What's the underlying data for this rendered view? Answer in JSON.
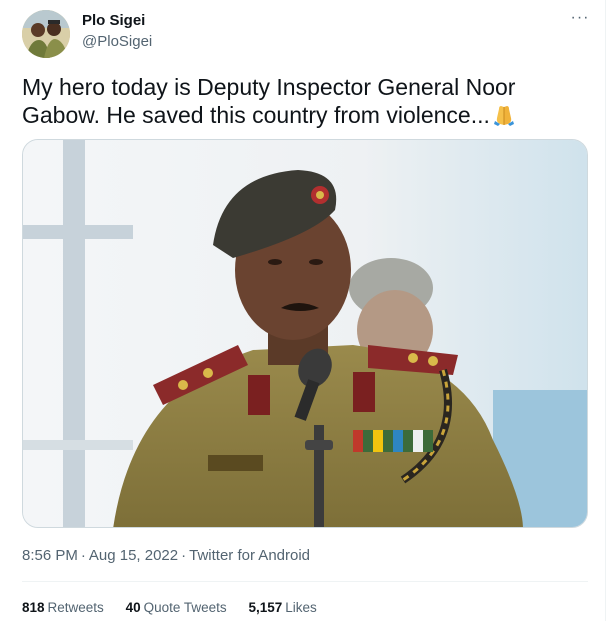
{
  "tweet": {
    "author": {
      "name": "Plo Sigei",
      "handle": "@PloSigei"
    },
    "more_icon": "more-horizontal-icon",
    "text": "My hero today is Deputy Inspector General Noor Gabow. He saved this country from violence...",
    "emoji": "folded-hands-emoji",
    "media": {
      "subject": "photo-man-in-military-uniform-speaking-at-microphone"
    },
    "meta": {
      "time": "8:56 PM",
      "date": "Aug 15, 2022",
      "separator": "·",
      "source": "Twitter for Android"
    },
    "stats": {
      "retweets_count": "818",
      "retweets_label": "Retweets",
      "quotes_count": "40",
      "quotes_label": "Quote Tweets",
      "likes_count": "5,157",
      "likes_label": "Likes"
    }
  },
  "colors": {
    "text_primary": "#0f1419",
    "text_secondary": "#536471",
    "border": "#cfd9de",
    "divider": "#eff3f4"
  }
}
